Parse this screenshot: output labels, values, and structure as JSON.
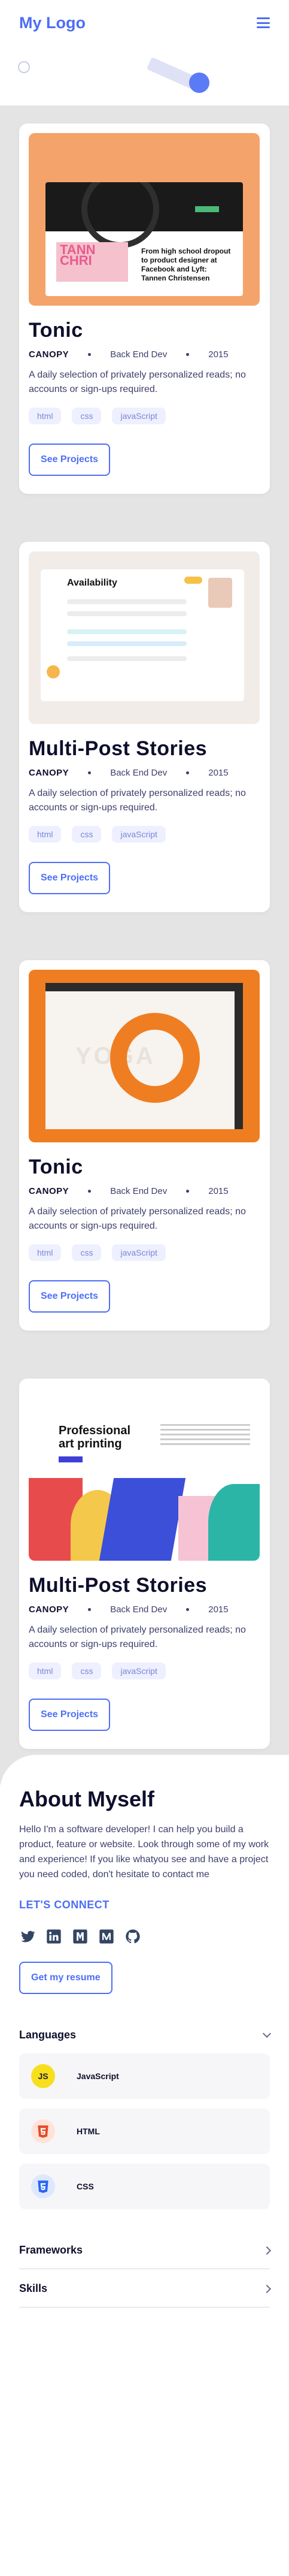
{
  "header": {
    "logo": "My Logo"
  },
  "projects": [
    {
      "title": "Tonic",
      "company": "CANOPY",
      "role": "Back End Dev",
      "year": "2015",
      "description": "A daily selection of privately personalized reads; no accounts or sign-ups required.",
      "tags": [
        "html",
        "css",
        "javaScript"
      ],
      "button": "See Projects",
      "thumb_text": {
        "pink": "TANN CHRI",
        "headline": "From high school dropout to product designer at Facebook and Lyft: Tannen Christensen"
      }
    },
    {
      "title": "Multi-Post Stories",
      "company": "CANOPY",
      "role": "Back End Dev",
      "year": "2015",
      "description": "A daily selection of privately personalized reads; no accounts or sign-ups required.",
      "tags": [
        "html",
        "css",
        "javaScript"
      ],
      "button": "See Projects",
      "thumb_text": {
        "title": "Availability"
      }
    },
    {
      "title": "Tonic",
      "company": "CANOPY",
      "role": "Back End Dev",
      "year": "2015",
      "description": "A daily selection of privately personalized reads; no accounts or sign-ups required.",
      "tags": [
        "html",
        "css",
        "javaScript"
      ],
      "button": "See Projects",
      "thumb_text": {
        "big": "YOGA"
      }
    },
    {
      "title": "Multi-Post Stories",
      "company": "CANOPY",
      "role": "Back End Dev",
      "year": "2015",
      "description": "A daily selection of privately personalized reads; no accounts or sign-ups required.",
      "tags": [
        "html",
        "css",
        "javaScript"
      ],
      "button": "See Projects",
      "thumb_text": {
        "headline": "Professional art printing"
      }
    }
  ],
  "about": {
    "title": "About Myself",
    "text": "Hello I'm a software developer! I can help you build a product, feature or website. Look through some of my work and experience! If you like whatyou see and have a project you need coded, don't hesitate to contact me",
    "connect": "LET'S CONNECT",
    "socials": [
      "twitter-icon",
      "linkedin-icon",
      "angellist-icon",
      "medium-icon",
      "github-icon"
    ],
    "resume_button": "Get my resume"
  },
  "skills": {
    "languages_label": "Languages",
    "languages": [
      {
        "name": "JavaScript",
        "icon": "JS",
        "color": "#f7df1e",
        "bg": "#f7df1e33"
      },
      {
        "name": "HTML",
        "icon": "5",
        "color": "#e44d26",
        "bg": "#e44d2633"
      },
      {
        "name": "CSS",
        "icon": "3",
        "color": "#2965f1",
        "bg": "#2965f133"
      }
    ],
    "frameworks_label": "Frameworks",
    "skills_label": "Skills"
  },
  "colors": {
    "accent": "#4c6ef5",
    "dark": "#0e0e2c",
    "text": "#3d3e6b",
    "section_bg": "#e4e4e4"
  }
}
